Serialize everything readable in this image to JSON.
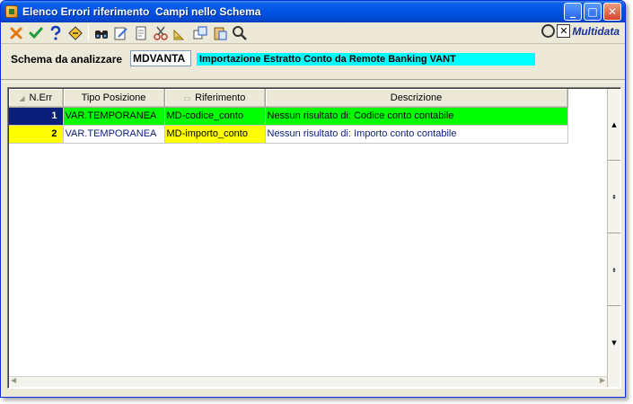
{
  "window": {
    "title": "Elenco Errori riferimento  Campi nello Schema",
    "minimize_glyph": "_",
    "maximize_glyph": "□",
    "close_glyph": "✕"
  },
  "toolbar": {
    "icons": [
      "cancel-icon",
      "confirm-icon",
      "help-icon",
      "diamond-tag-icon",
      "binoculars-icon",
      "edit-icon",
      "document-icon",
      "scissors-icon",
      "ruler-icon",
      "copy-window-icon",
      "paste-window-icon",
      "search-icon"
    ],
    "brand": "Multidata",
    "brand_mark": "✕"
  },
  "schema": {
    "label": "Schema da analizzare",
    "code": "MDVANTA",
    "description": "Importazione Estratto Conto da Remote Banking VANT",
    "description_bg": "#00ffff"
  },
  "grid": {
    "columns": [
      {
        "label": "N.Err"
      },
      {
        "label": "Tipo Posizione"
      },
      {
        "label": "Riferimento"
      },
      {
        "label": "Descrizione"
      }
    ],
    "rows": [
      {
        "n_err": "1",
        "tipo": "VAR.TEMPORANEA",
        "riferimento": "MD-codice_conto",
        "descrizione": "Nessun risultato di: Codice conto contabile",
        "num_bg": "#0a1e7a",
        "num_fg": "#ffffff",
        "row_bg": "#00ff00",
        "desc_fg": "#000000"
      },
      {
        "n_err": "2",
        "tipo": "VAR.TEMPORANEA",
        "riferimento": "MD-importo_conto",
        "descrizione": "Nessun risultato di: Importo conto contabile",
        "num_bg": "#ffff00",
        "num_fg": "#000000",
        "row_bg": "#ffffff",
        "desc_fg": "#0a1e7a"
      }
    ],
    "scroll_glyphs": [
      "▲",
      "⇞",
      "⇟",
      "▼"
    ]
  },
  "colors": {
    "titlebar": "#0054e3",
    "window_bg": "#ece9d8"
  }
}
